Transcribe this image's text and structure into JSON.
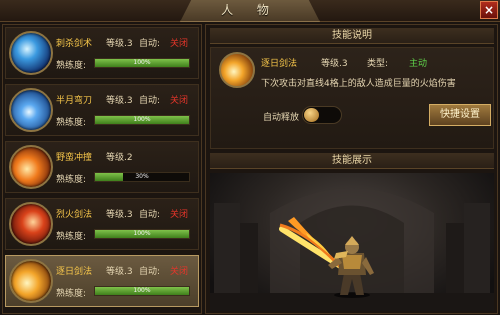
{
  "window": {
    "title": "人 物",
    "close_glyph": "×"
  },
  "skills": [
    {
      "name": "刺杀剑术",
      "level": "等级.3",
      "auto_label": "自动:",
      "auto_value": "关闭",
      "prof_label": "熟练度:",
      "prof_text": "100%",
      "prof_fraction": 1.0,
      "icon": "thrust-sword-icon",
      "selected": false
    },
    {
      "name": "半月弯刀",
      "level": "等级.3",
      "auto_label": "自动:",
      "auto_value": "关闭",
      "prof_label": "熟练度:",
      "prof_text": "100%",
      "prof_fraction": 1.0,
      "icon": "half-moon-blade-icon",
      "selected": false
    },
    {
      "name": "野蛮冲撞",
      "level": "等级.2",
      "prof_label": "熟练度:",
      "prof_text": "30%",
      "prof_fraction": 0.3,
      "icon": "savage-charge-icon",
      "selected": false
    },
    {
      "name": "烈火剑法",
      "level": "等级.3",
      "auto_label": "自动:",
      "auto_value": "关闭",
      "prof_label": "熟练度:",
      "prof_text": "100%",
      "prof_fraction": 1.0,
      "icon": "blazing-sword-icon",
      "selected": false
    },
    {
      "name": "逐日剑法",
      "level": "等级.3",
      "auto_label": "自动:",
      "auto_value": "关闭",
      "prof_label": "熟练度:",
      "prof_text": "100%",
      "prof_fraction": 1.0,
      "icon": "sun-chasing-sword-icon",
      "selected": true
    }
  ],
  "detail": {
    "section_title": "技能说明",
    "name": "逐日剑法",
    "level": "等级.3",
    "type_label": "类型:",
    "type_value": "主动",
    "description": "下次攻击对直线4格上的敌人造成巨量的火焰伤害",
    "auto_release_label": "自动释放",
    "auto_release_on": false,
    "quick_set_label": "快捷设置",
    "icon": "sun-chasing-sword-icon"
  },
  "showcase": {
    "section_title": "技能展示",
    "scene": "warrior-swinging-flaming-sword"
  },
  "colors": {
    "skill_name": "#f5c54a",
    "auto_off": "#e5352a",
    "skill_type_active": "#5fd34a",
    "prof_bar": "#5fa533"
  }
}
